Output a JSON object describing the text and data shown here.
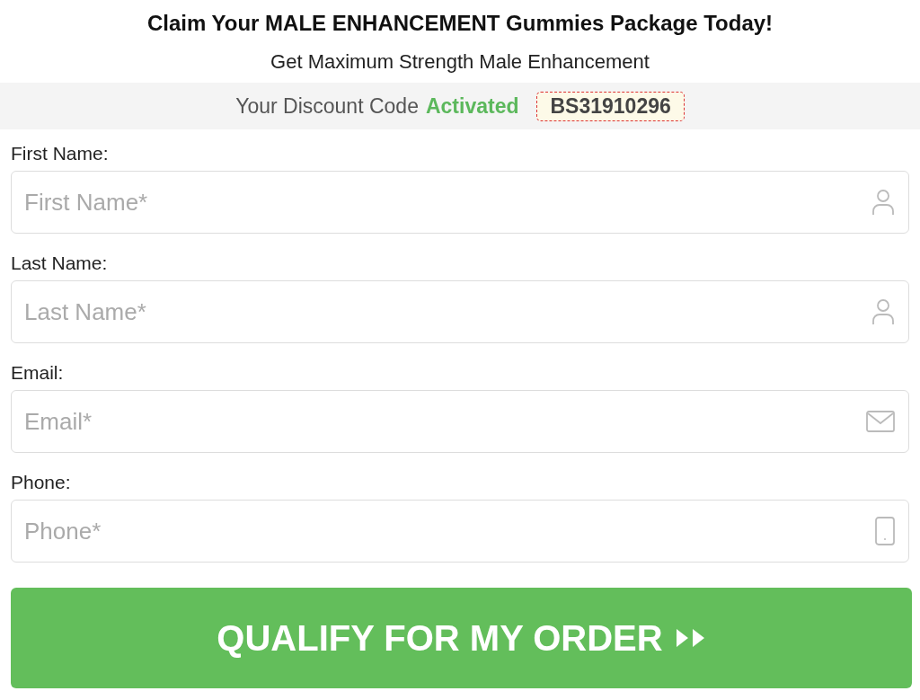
{
  "heading": "Claim Your MALE ENHANCEMENT Gummies Package Today!",
  "subheading": "Get Maximum Strength Male Enhancement",
  "discount": {
    "text": "Your Discount Code",
    "status": "Activated",
    "code": "BS31910296"
  },
  "fields": [
    {
      "label": "First Name:",
      "placeholder": "First Name*",
      "kind": "person"
    },
    {
      "label": "Last Name:",
      "placeholder": "Last Name*",
      "kind": "person"
    },
    {
      "label": "Email:",
      "placeholder": "Email*",
      "kind": "email"
    },
    {
      "label": "Phone:",
      "placeholder": "Phone*",
      "kind": "phone"
    }
  ],
  "submit": {
    "label": "QUALIFY FOR MY ORDER"
  }
}
